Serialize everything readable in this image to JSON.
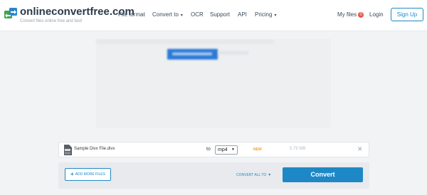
{
  "header": {
    "brand": "onlineconvertfree.com",
    "tagline": "Convert files online free and fast!",
    "nav": {
      "file_format": "File format",
      "convert_to": "Convert to",
      "ocr": "OCR",
      "support": "Support",
      "api": "API",
      "pricing": "Pricing"
    },
    "my_files": "My files",
    "my_files_count": "0",
    "login": "Login",
    "signup": "Sign Up"
  },
  "file": {
    "name": "Sample Divx File.divx",
    "to_label": "to",
    "format": "mp4",
    "status": "NEW",
    "size": "5.79 MB"
  },
  "actions": {
    "add_more": "ADD MORE FILES",
    "convert_all": "CONVERT ALL TO",
    "convert": "Convert"
  },
  "colors": {
    "accent": "#1e88c7",
    "badge": "#e3574b",
    "status_new": "#f0a030"
  },
  "icons": {
    "logo": "logo-arrows-icon",
    "file": "file-icon",
    "remove": "close-icon",
    "add": "plus-icon",
    "dropdown": "chevron-down-icon"
  }
}
